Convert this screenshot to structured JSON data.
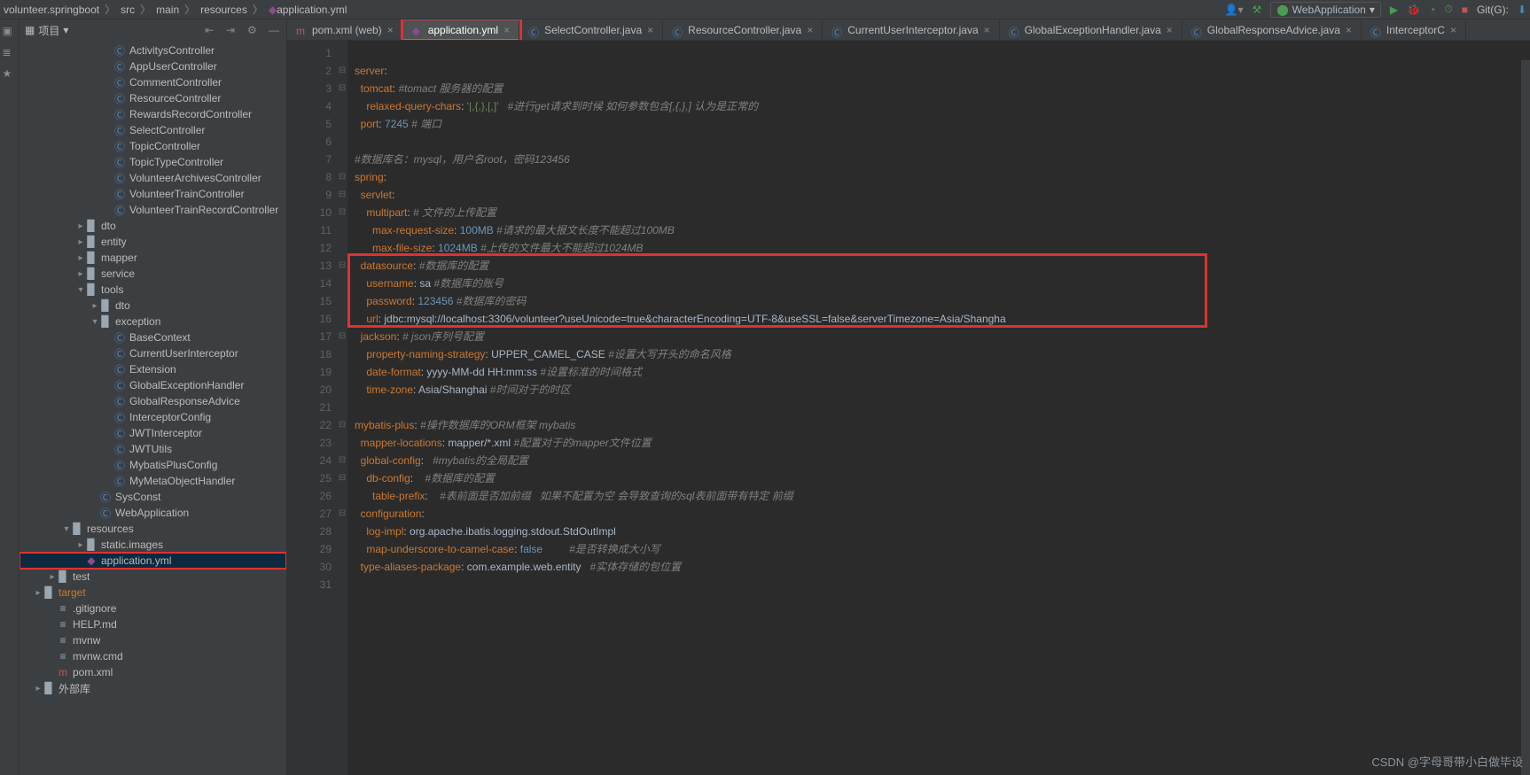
{
  "breadcrumbs": [
    "volunteer.springboot",
    "src",
    "main",
    "resources",
    "application.yml"
  ],
  "top_right": {
    "run_config": "WebApplication",
    "git_label": "Git(G):"
  },
  "panel": {
    "title": "项目",
    "icons": [
      "collapse",
      "expand",
      "gear",
      "hide"
    ]
  },
  "tree": [
    {
      "d": 6,
      "i": "class",
      "t": "ActivitysController"
    },
    {
      "d": 6,
      "i": "class",
      "t": "AppUserController"
    },
    {
      "d": 6,
      "i": "class",
      "t": "CommentController"
    },
    {
      "d": 6,
      "i": "class",
      "t": "ResourceController"
    },
    {
      "d": 6,
      "i": "class",
      "t": "RewardsRecordController"
    },
    {
      "d": 6,
      "i": "class",
      "t": "SelectController"
    },
    {
      "d": 6,
      "i": "class",
      "t": "TopicController"
    },
    {
      "d": 6,
      "i": "class",
      "t": "TopicTypeController"
    },
    {
      "d": 6,
      "i": "class",
      "t": "VolunteerArchivesController"
    },
    {
      "d": 6,
      "i": "class",
      "t": "VolunteerTrainController"
    },
    {
      "d": 6,
      "i": "class",
      "t": "VolunteerTrainRecordController"
    },
    {
      "d": 4,
      "c": ">",
      "i": "pkg",
      "t": "dto"
    },
    {
      "d": 4,
      "c": ">",
      "i": "pkg",
      "t": "entity"
    },
    {
      "d": 4,
      "c": ">",
      "i": "pkg",
      "t": "mapper"
    },
    {
      "d": 4,
      "c": ">",
      "i": "pkg",
      "t": "service"
    },
    {
      "d": 4,
      "c": "v",
      "i": "pkg",
      "t": "tools"
    },
    {
      "d": 5,
      "c": ">",
      "i": "pkg",
      "t": "dto"
    },
    {
      "d": 5,
      "c": "v",
      "i": "pkg",
      "t": "exception"
    },
    {
      "d": 6,
      "i": "class",
      "t": "BaseContext"
    },
    {
      "d": 6,
      "i": "class",
      "t": "CurrentUserInterceptor"
    },
    {
      "d": 6,
      "i": "class",
      "t": "Extension"
    },
    {
      "d": 6,
      "i": "class",
      "t": "GlobalExceptionHandler"
    },
    {
      "d": 6,
      "i": "class",
      "t": "GlobalResponseAdvice"
    },
    {
      "d": 6,
      "i": "class",
      "t": "InterceptorConfig"
    },
    {
      "d": 6,
      "i": "class",
      "t": "JWTInterceptor"
    },
    {
      "d": 6,
      "i": "class",
      "t": "JWTUtils"
    },
    {
      "d": 6,
      "i": "class",
      "t": "MybatisPlusConfig"
    },
    {
      "d": 6,
      "i": "class",
      "t": "MyMetaObjectHandler"
    },
    {
      "d": 5,
      "i": "class",
      "t": "SysConst"
    },
    {
      "d": 5,
      "i": "class",
      "t": "WebApplication"
    },
    {
      "d": 3,
      "c": "v",
      "i": "folder",
      "t": "resources"
    },
    {
      "d": 4,
      "c": ">",
      "i": "folder",
      "t": "static.images"
    },
    {
      "d": 4,
      "i": "yml",
      "t": "application.yml",
      "sel": true,
      "red": true
    },
    {
      "d": 2,
      "c": ">",
      "i": "folder",
      "t": "test"
    },
    {
      "d": 1,
      "c": ">",
      "i": "folder",
      "t": "target",
      "orange": true
    },
    {
      "d": 2,
      "i": "txt",
      "t": ".gitignore"
    },
    {
      "d": 2,
      "i": "txt",
      "t": "HELP.md"
    },
    {
      "d": 2,
      "i": "txt",
      "t": "mvnw"
    },
    {
      "d": 2,
      "i": "txt",
      "t": "mvnw.cmd"
    },
    {
      "d": 2,
      "i": "m",
      "t": "pom.xml"
    },
    {
      "d": 1,
      "c": ">",
      "i": "folder",
      "t": "外部库"
    }
  ],
  "tabs": [
    {
      "icon": "m",
      "label": "pom.xml (web)",
      "active": false
    },
    {
      "icon": "yml",
      "label": "application.yml",
      "active": true,
      "red": true
    },
    {
      "icon": "class",
      "label": "SelectController.java"
    },
    {
      "icon": "class",
      "label": "ResourceController.java"
    },
    {
      "icon": "class",
      "label": "CurrentUserInterceptor.java"
    },
    {
      "icon": "class",
      "label": "GlobalExceptionHandler.java"
    },
    {
      "icon": "class",
      "label": "GlobalResponseAdvice.java"
    },
    {
      "icon": "class",
      "label": "InterceptorC"
    }
  ],
  "code": [
    {
      "n": 1,
      "seg": [
        [
          "p",
          ""
        ]
      ]
    },
    {
      "n": 2,
      "seg": [
        [
          "k",
          "server"
        ],
        [
          "p",
          ":"
        ]
      ]
    },
    {
      "n": 3,
      "seg": [
        [
          "p",
          "  "
        ],
        [
          "k",
          "tomcat"
        ],
        [
          "p",
          ": "
        ],
        [
          "c",
          "#tomact 服务器的配置"
        ]
      ]
    },
    {
      "n": 4,
      "seg": [
        [
          "p",
          "    "
        ],
        [
          "k",
          "relaxed-query-chars"
        ],
        [
          "p",
          ": "
        ],
        [
          "s",
          "'|,{,},[,]'"
        ],
        [
          "p",
          "   "
        ],
        [
          "c",
          "#进行get请求到时候 如何参数包含[,{,},] 认为是正常的"
        ]
      ]
    },
    {
      "n": 5,
      "seg": [
        [
          "p",
          "  "
        ],
        [
          "k",
          "port"
        ],
        [
          "p",
          ": "
        ],
        [
          "n",
          "7245"
        ],
        [
          "p",
          " "
        ],
        [
          "c",
          "# 端口"
        ]
      ]
    },
    {
      "n": 6,
      "seg": [
        [
          "p",
          ""
        ]
      ]
    },
    {
      "n": 7,
      "seg": [
        [
          "c",
          "#数据库名：mysql，用户名root，密码123456"
        ]
      ]
    },
    {
      "n": 8,
      "seg": [
        [
          "k",
          "spring"
        ],
        [
          "p",
          ":"
        ]
      ]
    },
    {
      "n": 9,
      "seg": [
        [
          "p",
          "  "
        ],
        [
          "k",
          "servlet"
        ],
        [
          "p",
          ":"
        ]
      ]
    },
    {
      "n": 10,
      "seg": [
        [
          "p",
          "    "
        ],
        [
          "k",
          "multipart"
        ],
        [
          "p",
          ": "
        ],
        [
          "c",
          "# 文件的上传配置"
        ]
      ]
    },
    {
      "n": 11,
      "seg": [
        [
          "p",
          "      "
        ],
        [
          "k",
          "max-request-size"
        ],
        [
          "p",
          ": "
        ],
        [
          "n",
          "100MB"
        ],
        [
          "p",
          " "
        ],
        [
          "c",
          "#请求的最大报文长度不能超过100MB"
        ]
      ]
    },
    {
      "n": 12,
      "seg": [
        [
          "p",
          "      "
        ],
        [
          "k",
          "max-file-size"
        ],
        [
          "p",
          ": "
        ],
        [
          "n",
          "1024MB"
        ],
        [
          "p",
          " "
        ],
        [
          "c",
          "#上传的文件最大不能超过1024MB"
        ]
      ]
    },
    {
      "n": 13,
      "seg": [
        [
          "p",
          "  "
        ],
        [
          "k",
          "datasource"
        ],
        [
          "p",
          ": "
        ],
        [
          "c",
          "#数据库的配置"
        ]
      ]
    },
    {
      "n": 14,
      "seg": [
        [
          "p",
          "    "
        ],
        [
          "k",
          "username"
        ],
        [
          "p",
          ": "
        ],
        [
          "p",
          "sa "
        ],
        [
          "c",
          "#数据库的账号"
        ]
      ]
    },
    {
      "n": 15,
      "seg": [
        [
          "p",
          "    "
        ],
        [
          "k",
          "password"
        ],
        [
          "p",
          ": "
        ],
        [
          "n",
          "123456"
        ],
        [
          "p",
          " "
        ],
        [
          "c",
          "#数据库的密码"
        ]
      ]
    },
    {
      "n": 16,
      "seg": [
        [
          "p",
          "    "
        ],
        [
          "k",
          "url"
        ],
        [
          "p",
          ": "
        ],
        [
          "p",
          "jdbc:mysql://localhost:3306/volunteer?useUnicode=true&characterEncoding=UTF-8&useSSL=false&serverTimezone=Asia/Shangha"
        ]
      ]
    },
    {
      "n": 17,
      "seg": [
        [
          "p",
          "  "
        ],
        [
          "k",
          "jackson"
        ],
        [
          "p",
          ": "
        ],
        [
          "c",
          "# json序列号配置"
        ]
      ]
    },
    {
      "n": 18,
      "seg": [
        [
          "p",
          "    "
        ],
        [
          "k",
          "property-naming-strategy"
        ],
        [
          "p",
          ": UPPER_CAMEL_CASE "
        ],
        [
          "c",
          "#设置大写开头的命名风格"
        ]
      ]
    },
    {
      "n": 19,
      "seg": [
        [
          "p",
          "    "
        ],
        [
          "k",
          "date-format"
        ],
        [
          "p",
          ": yyyy-MM-dd HH:mm:ss "
        ],
        [
          "c",
          "#设置标准的时间格式"
        ]
      ]
    },
    {
      "n": 20,
      "seg": [
        [
          "p",
          "    "
        ],
        [
          "k",
          "time-zone"
        ],
        [
          "p",
          ": Asia/Shanghai "
        ],
        [
          "c",
          "#时间对于的时区"
        ]
      ]
    },
    {
      "n": 21,
      "seg": [
        [
          "p",
          ""
        ]
      ]
    },
    {
      "n": 22,
      "seg": [
        [
          "k",
          "mybatis-plus"
        ],
        [
          "p",
          ": "
        ],
        [
          "c",
          "#操作数据库的ORM框架 mybatis"
        ]
      ]
    },
    {
      "n": 23,
      "seg": [
        [
          "p",
          "  "
        ],
        [
          "k",
          "mapper-locations"
        ],
        [
          "p",
          ": mapper/*.xml "
        ],
        [
          "c",
          "#配置对于的mapper文件位置"
        ]
      ]
    },
    {
      "n": 24,
      "seg": [
        [
          "p",
          "  "
        ],
        [
          "k",
          "global-config"
        ],
        [
          "p",
          ":   "
        ],
        [
          "c",
          "#mybatis的全局配置"
        ]
      ]
    },
    {
      "n": 25,
      "seg": [
        [
          "p",
          "    "
        ],
        [
          "k",
          "db-config"
        ],
        [
          "p",
          ":    "
        ],
        [
          "c",
          "#数据库的配置"
        ]
      ]
    },
    {
      "n": 26,
      "seg": [
        [
          "p",
          "      "
        ],
        [
          "k",
          "table-prefix"
        ],
        [
          "p",
          ":    "
        ],
        [
          "c",
          "#表前面是否加前缀   如果不配置为空 会导致查询的sql表前面带有特定 前缀"
        ]
      ]
    },
    {
      "n": 27,
      "seg": [
        [
          "p",
          "  "
        ],
        [
          "k",
          "configuration"
        ],
        [
          "p",
          ":"
        ]
      ]
    },
    {
      "n": 28,
      "seg": [
        [
          "p",
          "    "
        ],
        [
          "k",
          "log-impl"
        ],
        [
          "p",
          ": org.apache.ibatis.logging.stdout.StdOutImpl"
        ]
      ]
    },
    {
      "n": 29,
      "seg": [
        [
          "p",
          "    "
        ],
        [
          "k",
          "map-underscore-to-camel-case"
        ],
        [
          "p",
          ": "
        ],
        [
          "n",
          "false"
        ],
        [
          "p",
          "         "
        ],
        [
          "c",
          "#是否转换成大小写"
        ]
      ]
    },
    {
      "n": 30,
      "seg": [
        [
          "p",
          "  "
        ],
        [
          "k",
          "type-aliases-package"
        ],
        [
          "p",
          ": com.example.web.entity   "
        ],
        [
          "c",
          "#实体存储的包位置"
        ]
      ]
    },
    {
      "n": 31,
      "seg": [
        [
          "p",
          ""
        ]
      ]
    }
  ],
  "watermark": "CSDN @字母哥带小白做毕设"
}
